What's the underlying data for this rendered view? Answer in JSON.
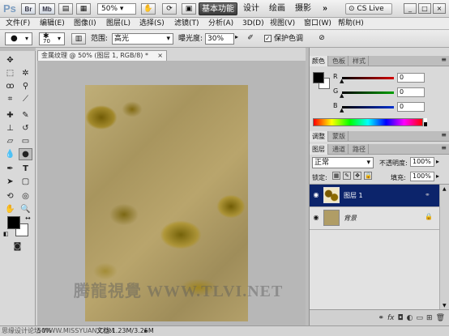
{
  "app": {
    "logo": "Ps"
  },
  "titlebar": {
    "br": "Br",
    "mb": "Mb",
    "zoom": "50%",
    "workspace_buttons": [
      "基本功能",
      "设计",
      "绘画",
      "摄影"
    ],
    "more": "»",
    "cslive": "CS Live",
    "win_min": "_",
    "win_max": "□",
    "win_close": "×"
  },
  "menubar": {
    "items": [
      "文件(F)",
      "编辑(E)",
      "图像(I)",
      "图层(L)",
      "选择(S)",
      "滤镜(T)",
      "分析(A)",
      "3D(D)",
      "视图(V)",
      "窗口(W)",
      "帮助(H)"
    ]
  },
  "options": {
    "brush_size": "70",
    "range_label": "范围:",
    "range_value": "高光",
    "exposure_label": "曝光度:",
    "exposure_value": "30%",
    "protect_tones_label": "保护色调"
  },
  "document": {
    "tab_title": "金属纹理 @ 50% (图层 1, RGB/8) *",
    "close": "×",
    "watermark": "腾龍視覺 WWW.TLVI.NET"
  },
  "status": {
    "zoom": "50%",
    "doc_size": "文档:1.23M/3.25M",
    "site": "思缘设计论坛 WWW.MISSYUAN.COM"
  },
  "color_panel": {
    "tabs": [
      "颜色",
      "色板",
      "样式"
    ],
    "channels": [
      {
        "label": "R",
        "value": "0",
        "color": "#d40000"
      },
      {
        "label": "G",
        "value": "0",
        "color": "#00a000"
      },
      {
        "label": "B",
        "value": "0",
        "color": "#0030d0"
      }
    ],
    "foreground": "#000000",
    "background": "#ffffff"
  },
  "adjust_panel": {
    "tabs": [
      "调整",
      "蒙版"
    ]
  },
  "layers_panel": {
    "tabs": [
      "图层",
      "通道",
      "路径"
    ],
    "blend_mode": "正常",
    "opacity_label": "不透明度:",
    "opacity_value": "100%",
    "lock_label": "锁定:",
    "fill_label": "填充:",
    "fill_value": "100%",
    "layers": [
      {
        "name": "图层 1",
        "selected": true
      },
      {
        "name": "背景",
        "selected": false
      }
    ]
  },
  "colors": {
    "accent_selected_layer": "#0c246b",
    "texture_base": "#b09d66"
  }
}
